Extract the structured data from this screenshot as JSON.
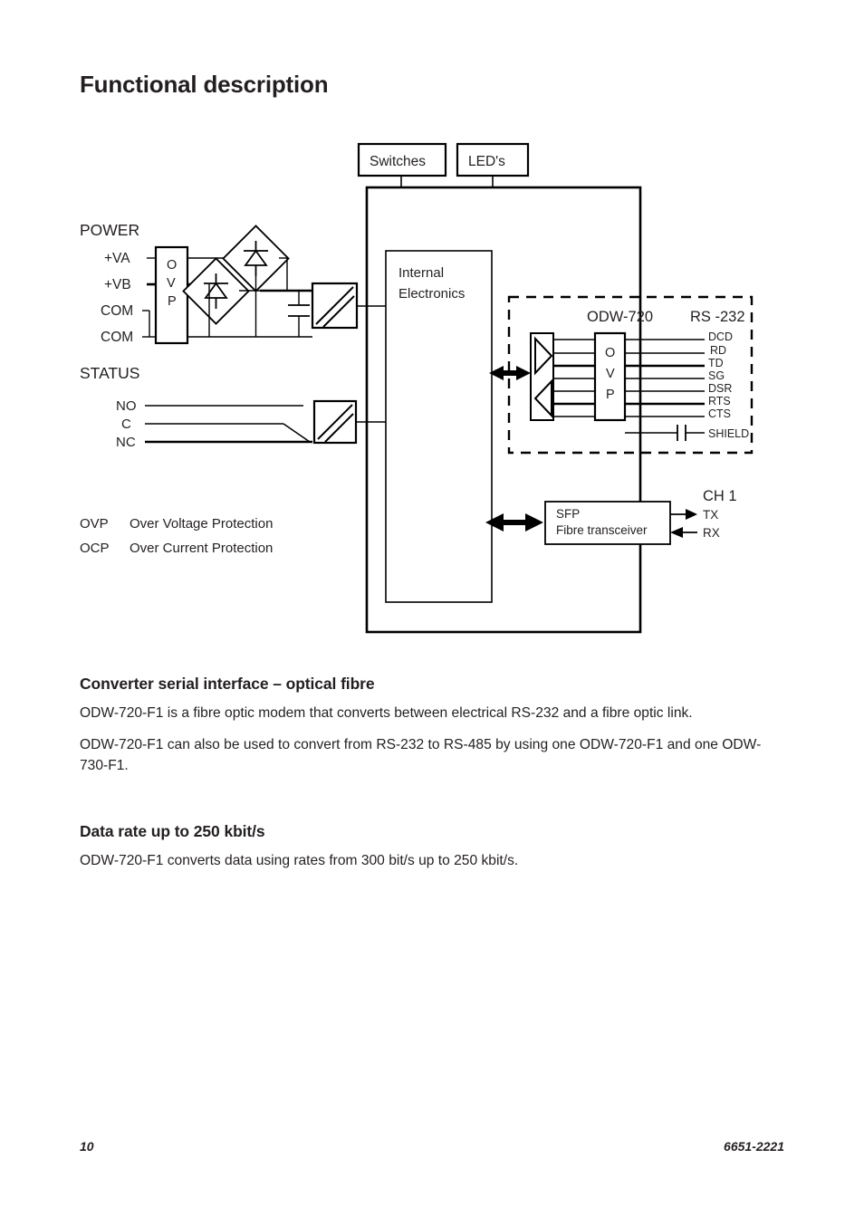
{
  "document": {
    "title": "Functional description"
  },
  "diagram": {
    "top_boxes": [
      {
        "label": "Switches"
      },
      {
        "label": "LED's"
      }
    ],
    "internal_box": {
      "line1": "Internal",
      "line2": "Electronics"
    },
    "power": {
      "group_label": "POWER",
      "terminals": [
        "+VA",
        "+VB",
        "COM",
        "COM"
      ],
      "ovp_letters": [
        "O",
        "V",
        "P"
      ]
    },
    "status": {
      "group_label": "STATUS",
      "terminals": [
        "NO",
        "C",
        "NC"
      ]
    },
    "serial": {
      "module_label": "ODW-720",
      "interface_label": "RS -232",
      "ovp_letters": [
        "O",
        "V",
        "P"
      ],
      "signals": [
        "DCD",
        "RD",
        "TD",
        "SG",
        "DSR",
        "RTS",
        "CTS"
      ],
      "shield_label": "SHIELD"
    },
    "sfp": {
      "line1": "SFP",
      "line2": "Fibre transceiver",
      "channel_label": "CH 1",
      "tx_label": "TX",
      "rx_label": "RX"
    },
    "legend": [
      {
        "abbr": "OVP",
        "text": "Over Voltage Protection"
      },
      {
        "abbr": "OCP",
        "text": "Over Current Protection"
      }
    ]
  },
  "sections": [
    {
      "heading": "Converter serial interface – optical fibre",
      "paragraphs": [
        "ODW-720-F1 is a fibre optic modem that converts between electrical RS-232 and a fibre optic link.",
        "ODW-720-F1 can also be used to convert from RS-232 to RS-485 by using one ODW-720-F1 and one ODW-730-F1."
      ]
    },
    {
      "heading": "Data rate up to 250 kbit/s",
      "paragraphs": [
        "ODW-720-F1 converts data using rates from 300 bit/s up to 250 kbit/s."
      ]
    }
  ],
  "footer": {
    "page_number": "10",
    "document_number": "6651-2221"
  },
  "colors": {
    "ink": "#231f20",
    "paper": "#ffffff"
  }
}
